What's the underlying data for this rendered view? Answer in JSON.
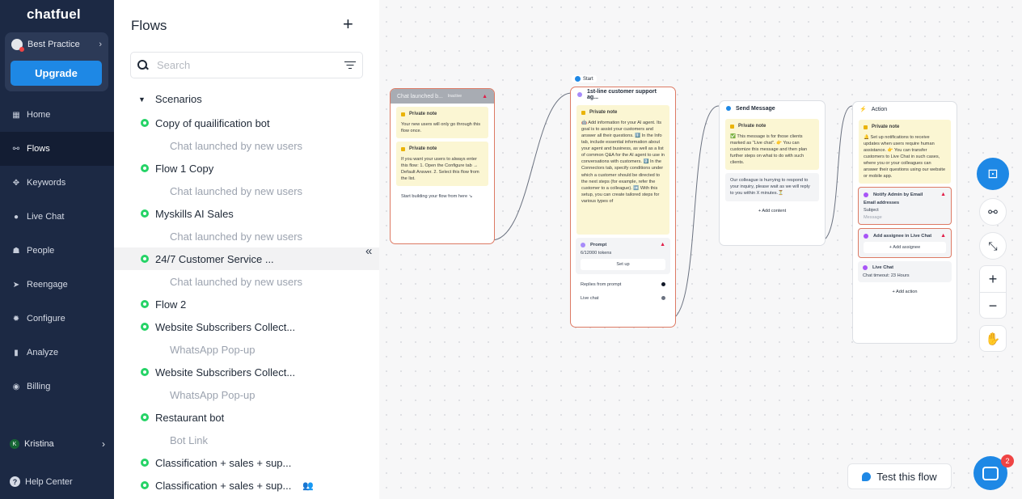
{
  "brand": {
    "logo": "chatfuel",
    "accent": "#1e88e5",
    "sidebar_bg": "#1c2944"
  },
  "account": {
    "name": "Best Practice",
    "upgrade_label": "Upgrade"
  },
  "nav": {
    "items": [
      {
        "label": "Home",
        "icon": "home-icon"
      },
      {
        "label": "Flows",
        "icon": "flows-icon",
        "active": true
      },
      {
        "label": "Keywords",
        "icon": "keywords-icon"
      },
      {
        "label": "Live Chat",
        "icon": "live-chat-icon"
      },
      {
        "label": "People",
        "icon": "people-icon"
      },
      {
        "label": "Reengage",
        "icon": "reengage-icon"
      },
      {
        "label": "Configure",
        "icon": "gear-icon"
      },
      {
        "label": "Analyze",
        "icon": "analyze-icon"
      },
      {
        "label": "Billing",
        "icon": "billing-icon"
      }
    ],
    "user": {
      "initial": "K",
      "name": "Kristina"
    },
    "help": "Help Center"
  },
  "flows_panel": {
    "title": "Flows",
    "search_placeholder": "Search",
    "group": "Scenarios",
    "items": [
      {
        "name": "Copy of quailification bot",
        "trigger": "Chat launched by new users"
      },
      {
        "name": "Flow 1 Copy",
        "trigger": "Chat launched by new users"
      },
      {
        "name": "Myskills AI Sales",
        "trigger": "Chat launched by new users"
      },
      {
        "name": "24/7 Customer Service ...",
        "trigger": "Chat launched by new users",
        "active": true
      },
      {
        "name": "Flow 2",
        "trigger": ""
      },
      {
        "name": "Website Subscribers Collect...",
        "trigger": "WhatsApp Pop-up"
      },
      {
        "name": "Website Subscribers Collect...",
        "trigger": "WhatsApp Pop-up"
      },
      {
        "name": "Restaurant bot",
        "trigger": "Bot Link"
      },
      {
        "name": "Classification + sales + sup...",
        "trigger": ""
      },
      {
        "name": "Classification + sales + sup...",
        "trigger": ""
      }
    ]
  },
  "canvas": {
    "start_label": "Start",
    "node1": {
      "title": "Chat launched b...",
      "badge": "Inactive",
      "note1_title": "Private note",
      "note1_text": "Your new users will only go through this flow once.",
      "note2_title": "Private note",
      "note2_text": "If you want your users to always enter this flow: 1. Open the Configure tab → Default Answer. 2. Select this flow from the list.",
      "footer": "Start building your flow from here ↘"
    },
    "node2": {
      "title": "1st-line customer support ag...",
      "note_title": "Private note",
      "note_text": "🤖 Add information for your AI agent. Its goal is to assist your customers and answer all their questions. 1️⃣ In the Info tab, include essential information about your agent and business, as well as a list of common Q&A for the AI agent to use in conversations with customers. 2️⃣ In the Connectors tab, specify conditions under which a customer should be directed to the next steps (for example, refer the customer to a colleague). ➡️ With this setup, you can create tailored steps for various types of",
      "prompt_title": "Prompt",
      "prompt_tokens": "6/12000 tokens",
      "setup_label": "Set up",
      "reply1": "Replies from prompt",
      "reply2": "Live chat"
    },
    "node3": {
      "title": "Send Message",
      "note_title": "Private note",
      "note_text": "✅ This message is for those clients marked as \"Live chat\". 👉 You can customize this message and then plan further steps on what to do with such clients.",
      "message": "Our colleague is hurrying to respond to your inquiry, please wait as we will reply to you within X minutes.⏳",
      "add_content": "+ Add content"
    },
    "node4": {
      "title": "Action",
      "note_title": "Private note",
      "note_text": "🔔 Set up notifications to receive updates when users require human assistance. 👉 You can transfer customers to Live Chat in such cases, where you or your colleagues can answer their questions using our website or mobile app.",
      "notify_title": "Notify Admin by Email",
      "notify_field": "Email addresses",
      "notify_subject": "Subject",
      "notify_message": "Message",
      "assignee_title": "Add assignee in Live Chat",
      "assignee_btn": "+ Add assignee",
      "livechat_title": "Live Chat",
      "livechat_timeout": "Chat timeout: 23 Hours",
      "add_action": "+ Add action"
    },
    "test_label": "Test this flow",
    "chat_badge": "2"
  }
}
